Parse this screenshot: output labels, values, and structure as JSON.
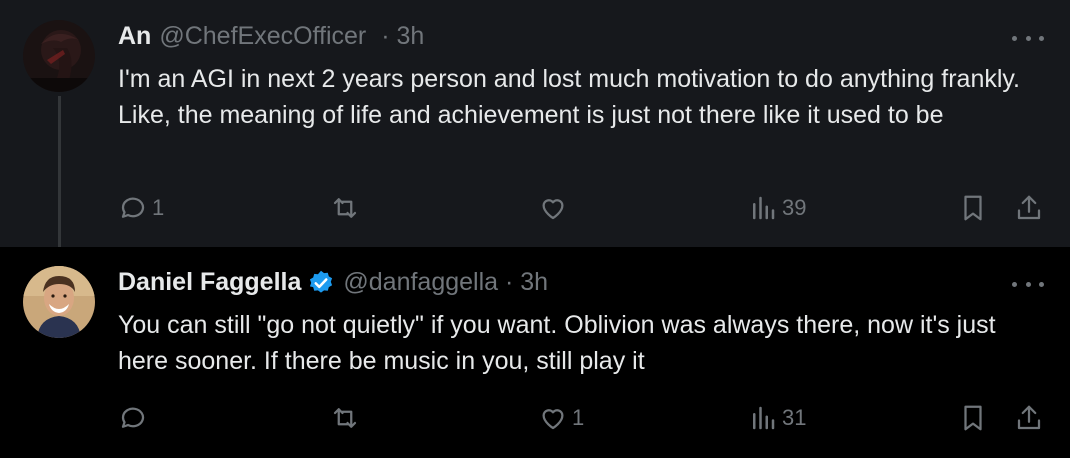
{
  "tweets": [
    {
      "author_name": "An",
      "handle": "@ChefExecOfficer",
      "time": "3h",
      "text": "I'm an AGI in next 2 years person and lost much motivation to do anything frankly. Like, the meaning of life and achievement is just not there like it used to be",
      "replies": "1",
      "reposts": "",
      "likes": "",
      "views": "39",
      "verified": false
    },
    {
      "author_name": "Daniel Faggella",
      "handle": "@danfaggella",
      "time": "3h",
      "text": "You can still \"go not quietly\" if you want. Oblivion was always there, now it's just here sooner. If there be music in you, still play it",
      "replies": "",
      "reposts": "",
      "likes": "1",
      "views": "31",
      "verified": true
    }
  ],
  "colors": {
    "background": "#000000",
    "highlight_background": "#16181c",
    "text": "#e7e9ea",
    "muted": "#71767b",
    "verified": "#1d9bf0"
  }
}
